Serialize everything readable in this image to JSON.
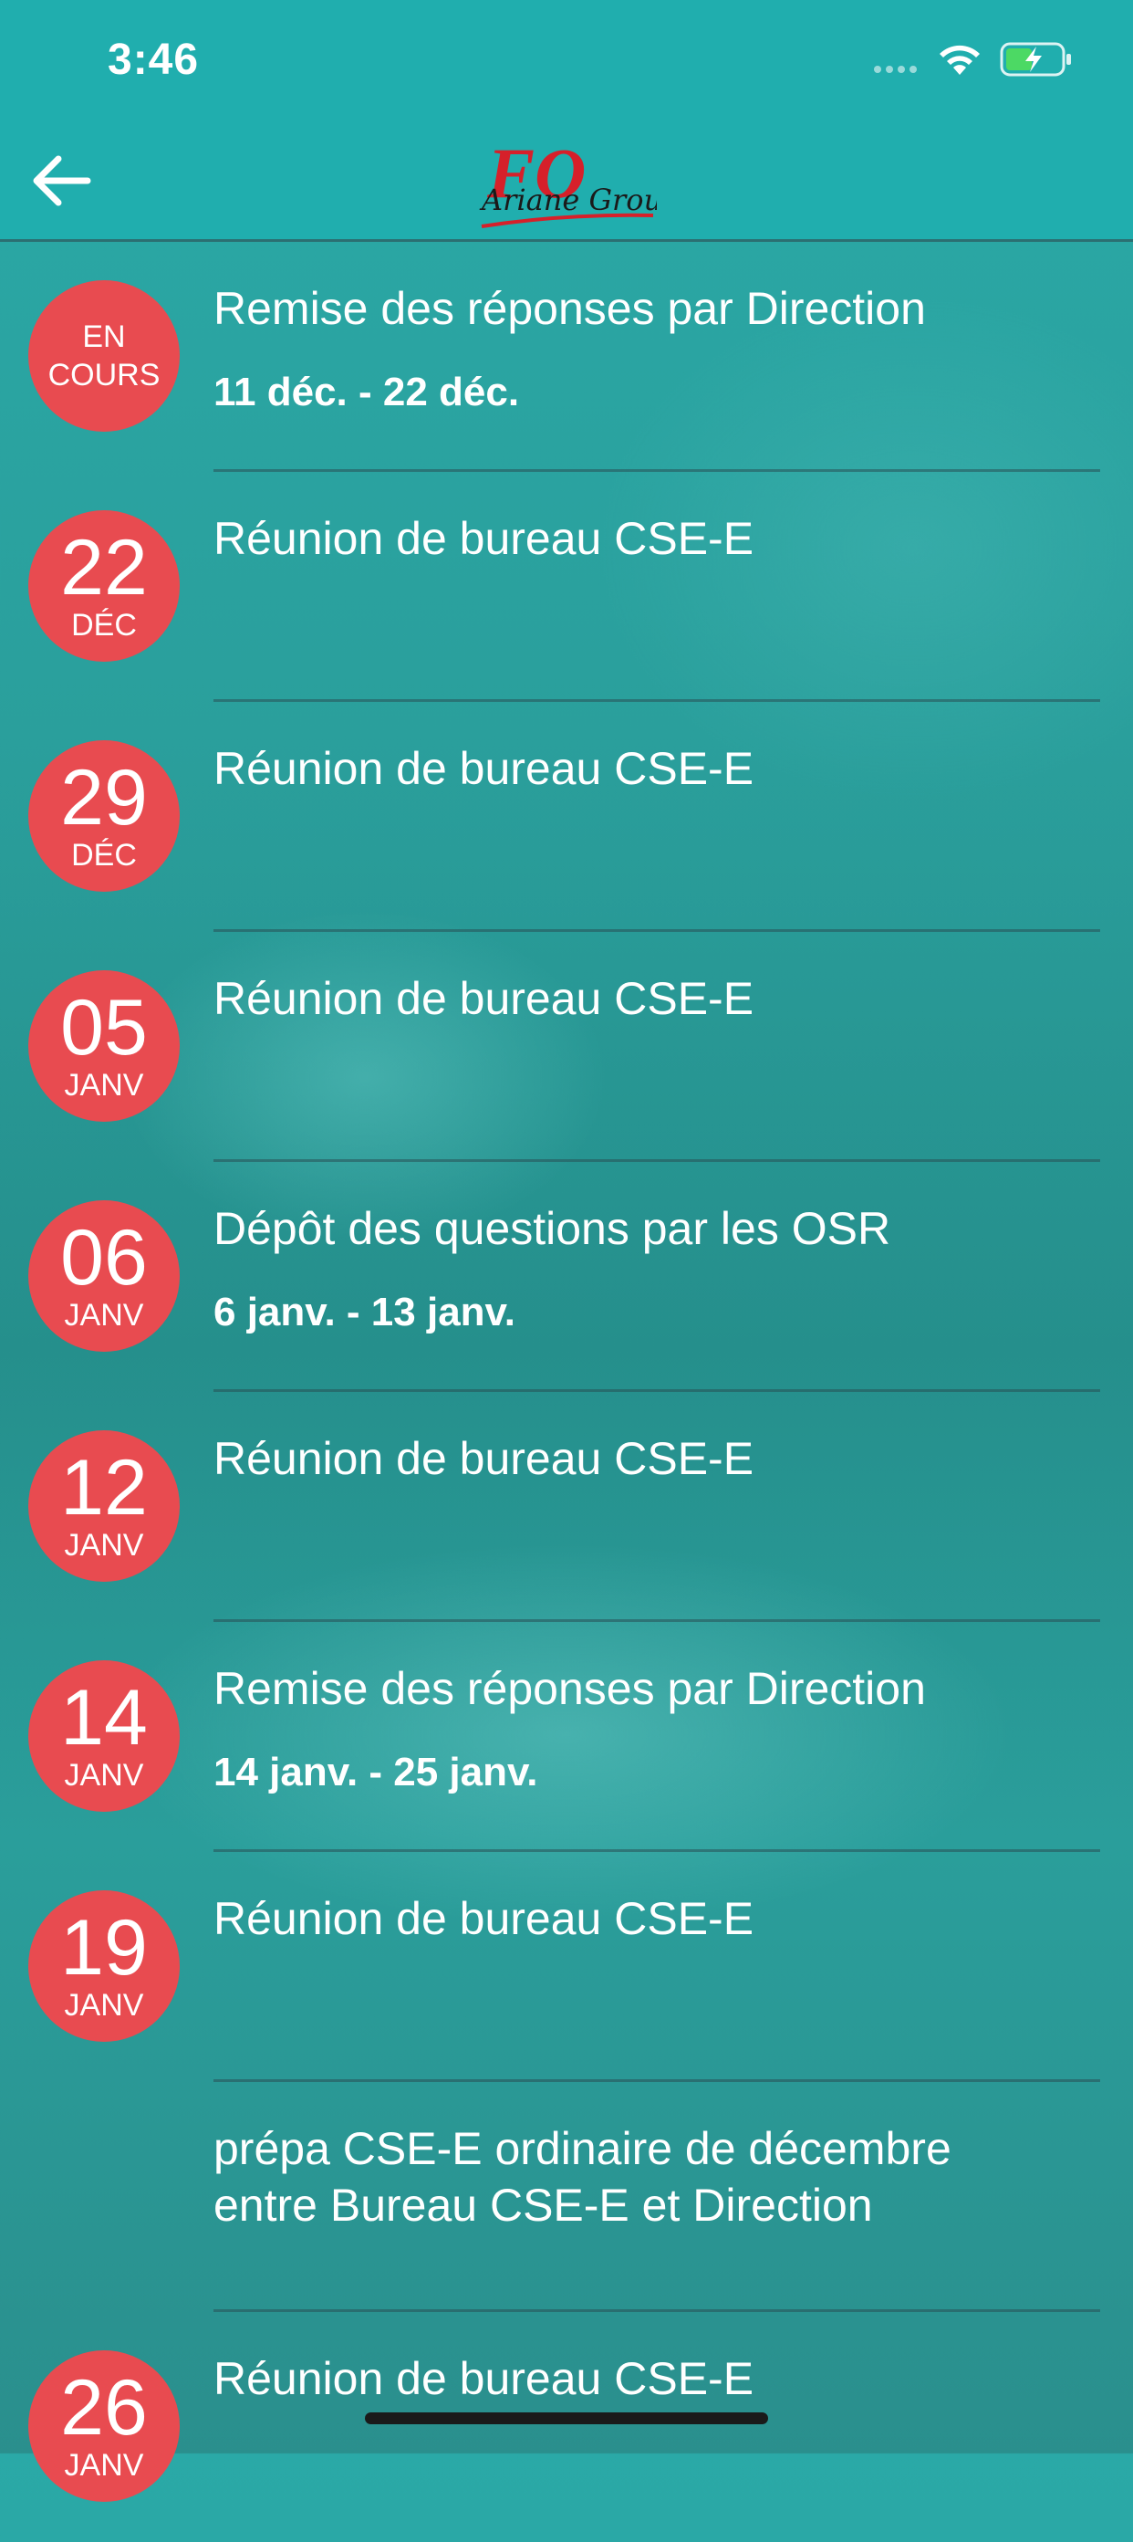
{
  "status_bar": {
    "time": "3:46"
  },
  "header": {
    "logo_text_main": "FO",
    "logo_text_sub": "Ariane Group"
  },
  "events": [
    {
      "badge_status": "EN\nCOURS",
      "title": "Remise des réponses par Direction",
      "range": "11 déc. - 22 déc."
    },
    {
      "day": "22",
      "month": "DÉC",
      "title": "Réunion de bureau CSE-E"
    },
    {
      "day": "29",
      "month": "DÉC",
      "title": "Réunion de bureau CSE-E"
    },
    {
      "day": "05",
      "month": "JANV",
      "title": "Réunion de bureau CSE-E"
    },
    {
      "day": "06",
      "month": "JANV",
      "title": "Dépôt des questions par les OSR",
      "range": "6 janv. - 13 janv."
    },
    {
      "day": "12",
      "month": "JANV",
      "title": "Réunion de bureau CSE-E"
    },
    {
      "day": "14",
      "month": "JANV",
      "title": "Remise des réponses par Direction",
      "range": "14 janv. - 25 janv."
    },
    {
      "day": "19",
      "month": "JANV",
      "title": "Réunion de bureau CSE-E"
    },
    {
      "title": "prépa CSE-E ordinaire de décembre entre Bureau CSE-E et Direction"
    },
    {
      "day": "26",
      "month": "JANV",
      "title": "Réunion de bureau CSE-E"
    }
  ],
  "colors": {
    "badge": "#e84b50",
    "header": "#20aeae"
  }
}
